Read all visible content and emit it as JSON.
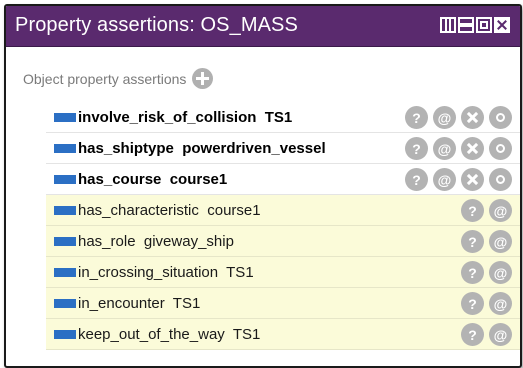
{
  "window": {
    "title": "Property assertions: OS_MASS",
    "colors": {
      "titlebar": "#5a2a6e",
      "asserted_bg": "#ffffff",
      "inferred_bg": "#fbfbd9",
      "property_bar": "#2b6fc4"
    }
  },
  "section": {
    "label": "Object property assertions",
    "add_icon": "plus-circle-icon"
  },
  "rows": [
    {
      "text": "involve_risk_of_collision  TS1",
      "kind": "asserted",
      "actions": [
        "?",
        "@",
        "x",
        "o"
      ]
    },
    {
      "text": "has_shiptype  powerdriven_vessel",
      "kind": "asserted",
      "actions": [
        "?",
        "@",
        "x",
        "o"
      ]
    },
    {
      "text": "has_course  course1",
      "kind": "asserted",
      "actions": [
        "?",
        "@",
        "x",
        "o"
      ]
    },
    {
      "text": "has_characteristic  course1",
      "kind": "inferred",
      "actions": [
        "?",
        "@"
      ]
    },
    {
      "text": "has_role  giveway_ship",
      "kind": "inferred",
      "actions": [
        "?",
        "@"
      ]
    },
    {
      "text": "in_crossing_situation  TS1",
      "kind": "inferred",
      "actions": [
        "?",
        "@"
      ]
    },
    {
      "text": "in_encounter  TS1",
      "kind": "inferred",
      "actions": [
        "?",
        "@"
      ]
    },
    {
      "text": "keep_out_of_the_way  TS1",
      "kind": "inferred",
      "actions": [
        "?",
        "@"
      ]
    }
  ],
  "action_labels": {
    "explain": "?",
    "annotate": "@"
  }
}
